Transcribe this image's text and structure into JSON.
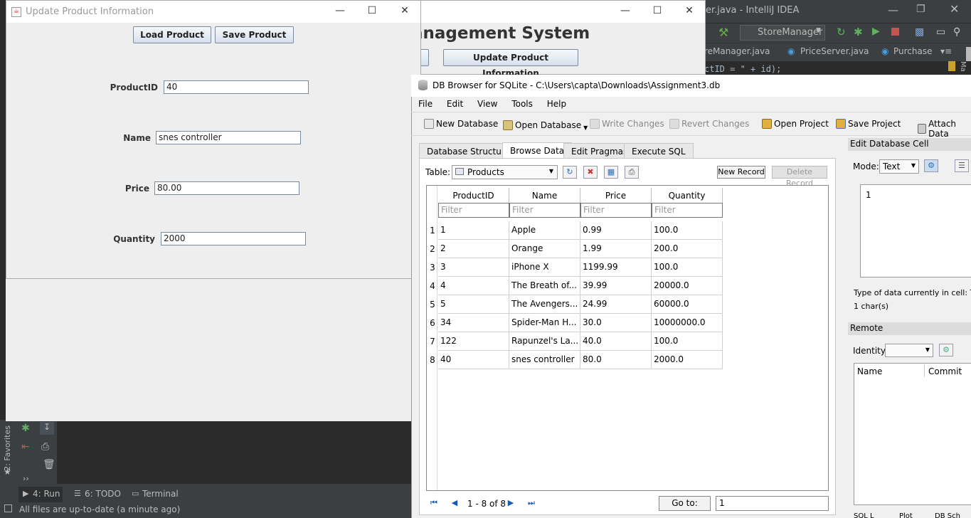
{
  "ide": {
    "title": "er.java - IntelliJ IDEA",
    "run_config": "StoreManager",
    "tabs": [
      "reManager.java",
      "PriceServer.java",
      "Purchase"
    ],
    "code_snippet": "ctID = \" + id);",
    "maven_label": "Ma",
    "side_tab_favorites": "2: Favorites",
    "bottom_tabs": [
      "4: Run",
      "6: TODO",
      "Terminal"
    ],
    "status": "All files are up-to-date (a minute ago)"
  },
  "mgmt_window": {
    "heading": "anagement System",
    "button_partial": "e",
    "button_update": "Update Product Information"
  },
  "update_window": {
    "title": "Update Product Information",
    "load_button": "Load Product",
    "save_button": "Save Product",
    "fields": {
      "product_id": {
        "label": "ProductID",
        "value": "40"
      },
      "name": {
        "label": "Name",
        "value": "snes controller"
      },
      "price": {
        "label": "Price",
        "value": "80.00"
      },
      "quantity": {
        "label": "Quantity",
        "value": "2000"
      }
    }
  },
  "dbb": {
    "title": "DB Browser for SQLite - C:\\Users\\capta\\Downloads\\Assignment3.db",
    "menu": [
      "File",
      "Edit",
      "View",
      "Tools",
      "Help"
    ],
    "toolbar": {
      "new_db": "New Database",
      "open_db": "Open Database",
      "write": "Write Changes",
      "revert": "Revert Changes",
      "open_project": "Open Project",
      "save_project": "Save Project",
      "attach": "Attach Data"
    },
    "tabs": [
      "Database Structure",
      "Browse Data",
      "Edit Pragmas",
      "Execute SQL"
    ],
    "table_label": "Table:",
    "table_value": "Products",
    "new_record": "New Record",
    "delete_record": "Delete Record",
    "columns": [
      "ProductID",
      "Name",
      "Price",
      "Quantity"
    ],
    "filter_placeholder": "Filter",
    "rows": [
      [
        "1",
        "1",
        "Apple",
        "0.99",
        "100.0"
      ],
      [
        "2",
        "2",
        "Orange",
        "1.99",
        "200.0"
      ],
      [
        "3",
        "3",
        "iPhone X",
        "1199.99",
        "100.0"
      ],
      [
        "4",
        "4",
        "The Breath of...",
        "39.99",
        "20000.0"
      ],
      [
        "5",
        "5",
        "The Avengers...",
        "24.99",
        "60000.0"
      ],
      [
        "6",
        "34",
        "Spider-Man H...",
        "30.0",
        "10000000.0"
      ],
      [
        "7",
        "122",
        "Rapunzel's La...",
        "40.0",
        "100.0"
      ],
      [
        "8",
        "40",
        "snes controller",
        "80.0",
        "2000.0"
      ]
    ],
    "pager": "1 - 8 of 8",
    "goto_label": "Go to:",
    "goto_value": "1",
    "edit_cell": {
      "header": "Edit Database Cell",
      "mode_label": "Mode:",
      "mode_value": "Text",
      "cell_value": "1",
      "type_info": "Type of data currently in cell: Text",
      "size_info": "1 char(s)"
    },
    "remote": {
      "header": "Remote",
      "identity_label": "Identity",
      "col_name": "Name",
      "col_commit": "Commit"
    },
    "bottom_tabs": [
      "SQL L",
      "Plot",
      "DB Sch"
    ]
  }
}
